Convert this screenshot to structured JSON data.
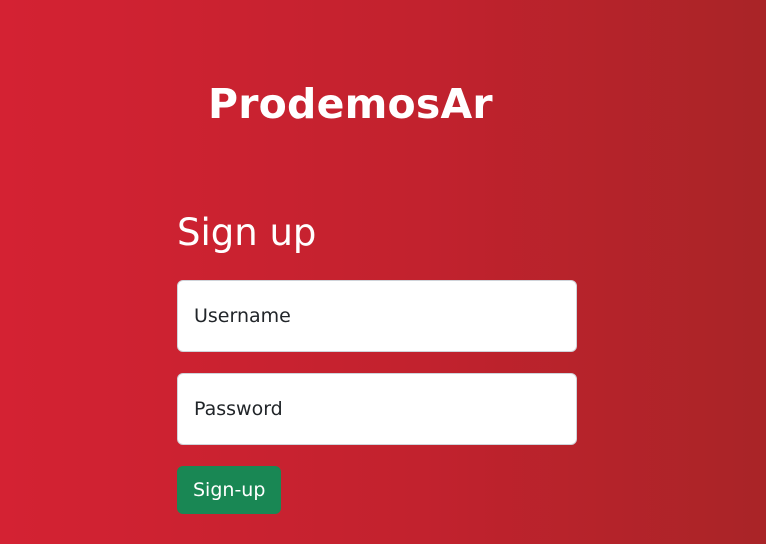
{
  "brand": {
    "logo_text": "ProdemosAr"
  },
  "form": {
    "title": "Sign up",
    "username_placeholder": "Username",
    "username_value": "",
    "password_placeholder": "Password",
    "password_value": "",
    "submit_label": "Sign-up"
  },
  "colors": {
    "background_gradient": [
      "#d42233",
      "#a92427"
    ],
    "primary_button": "#198754",
    "text_on_red": "#ffffff"
  }
}
